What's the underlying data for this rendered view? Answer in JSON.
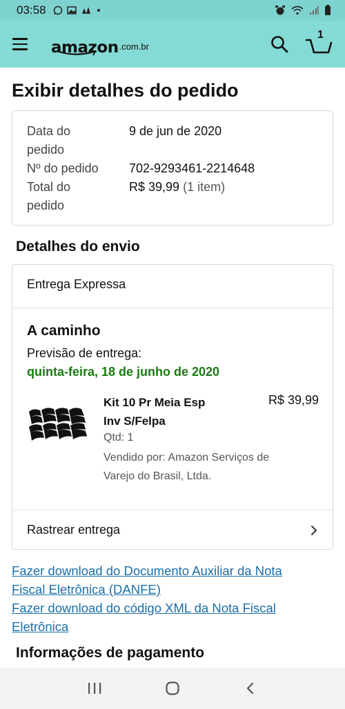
{
  "status_bar": {
    "time": "03:58",
    "left_icons": [
      "whatsapp-icon",
      "gallery-icon",
      "notification-icon",
      "dot-icon"
    ],
    "right_icons": [
      "alarm-icon",
      "wifi-icon",
      "signal-icon",
      "battery-icon"
    ]
  },
  "header": {
    "logo_main": "amazon",
    "logo_sub": ".com.br",
    "cart_count": "1"
  },
  "page": {
    "title": "Exibir detalhes do pedido"
  },
  "order_summary": {
    "date_label_1": "Data do",
    "date_label_2": "pedido",
    "date_value": "9 de jun de 2020",
    "number_label": "Nº do pedido",
    "number_value": "702-9293461-2214648",
    "total_label_1": "Total do",
    "total_label_2": "pedido",
    "total_value": "R$ 39,99",
    "total_items": "(1 item)"
  },
  "shipping": {
    "section_title": "Detalhes do envio",
    "ship_type": "Entrega Expressa",
    "status": "A caminho",
    "delivery_label": "Previsão de entrega:",
    "delivery_date": "quinta-feira, 18 de junho de 2020",
    "delivery_date_color": "#1a7a12",
    "product": {
      "title_line1": "Kit 10 Pr Meia Esp",
      "title_line2": "Inv S/Felpa",
      "price": "R$ 39,99",
      "qty": "Qtd: 1",
      "seller_line1": "Vendido por: Amazon Serviços de",
      "seller_line2": "Varejo do Brasil, Ltda."
    },
    "track_label": "Rastrear entrega"
  },
  "links": {
    "danfe_line1": "Fazer download do Documento Auxiliar da Nota",
    "danfe_line2": "Fiscal Eletrônica (DANFE)",
    "xml_line1": "Fazer download do código XML da Nota Fiscal",
    "xml_line2": "Eletrônica",
    "link_color": "#1b6fa8"
  },
  "payment": {
    "section_title": "Informações de pagamento"
  },
  "colors": {
    "header_bg": "#84dad4",
    "status_bar_bg": "#7fd3cf"
  }
}
